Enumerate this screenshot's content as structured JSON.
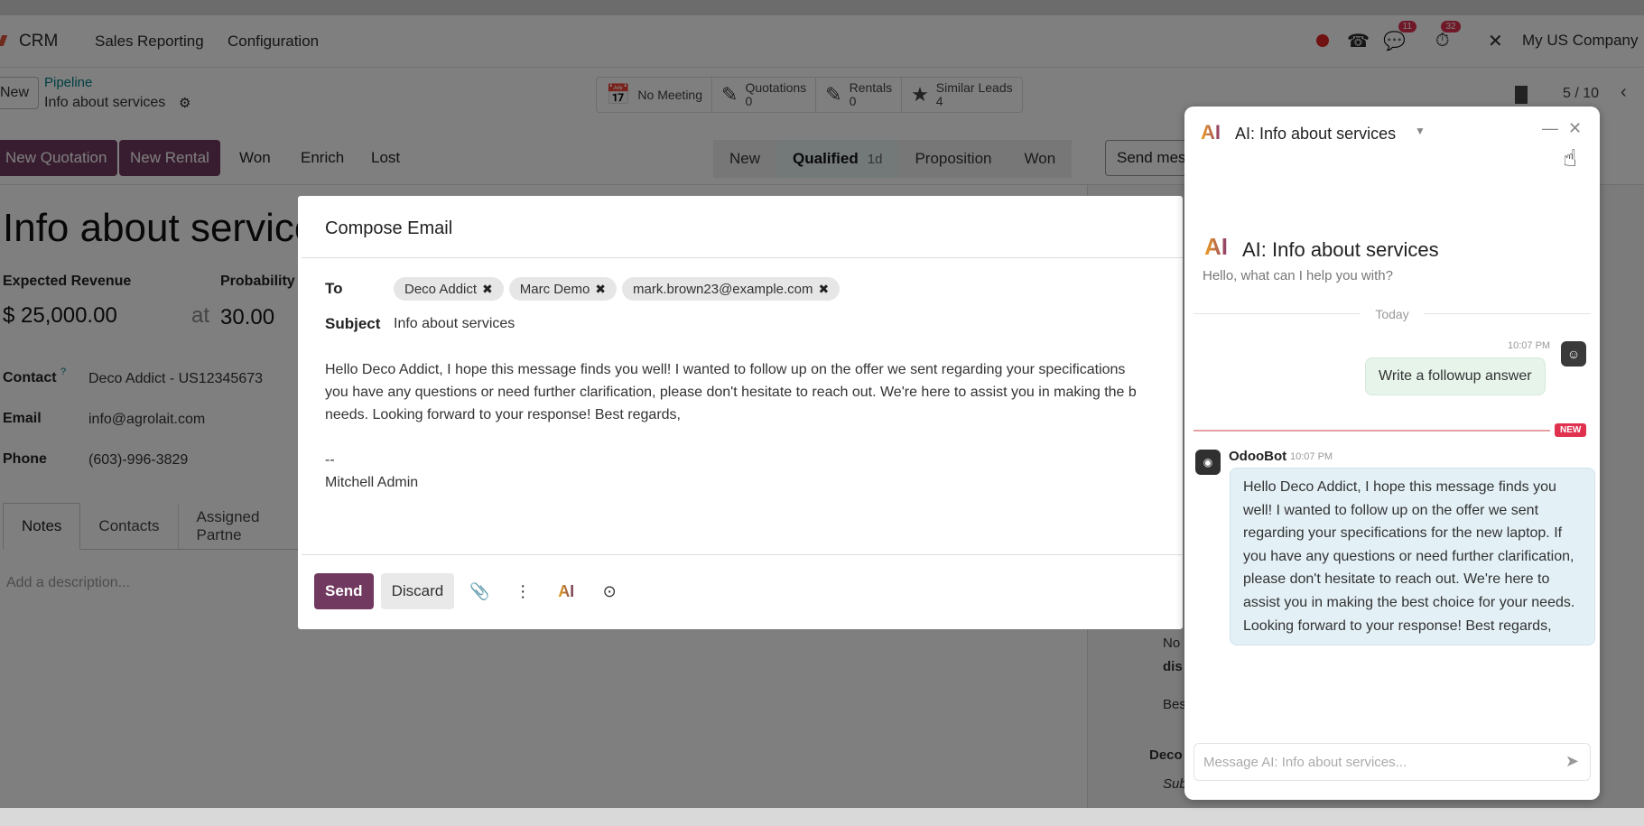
{
  "navbar": {
    "app": "CRM",
    "menu": [
      "Sales",
      "Reporting",
      "Configuration"
    ],
    "chat_badge": "11",
    "activity_badge": "32",
    "company": "My US Company"
  },
  "breadcrumb": {
    "new_label": "New",
    "parent": "Pipeline",
    "current": "Info about services"
  },
  "smart_buttons": [
    {
      "icon": "calendar-icon",
      "glyph": "📅",
      "label": "No Meeting",
      "count": ""
    },
    {
      "icon": "edit-icon",
      "glyph": "✎",
      "label": "Quotations",
      "count": "0"
    },
    {
      "icon": "edit-icon",
      "glyph": "✎",
      "label": "Rentals",
      "count": "0"
    },
    {
      "icon": "star-icon",
      "glyph": "★",
      "label": "Similar Leads",
      "count": "4"
    }
  ],
  "pager": "5 / 10",
  "statusbar": {
    "new_quotation": "New Quotation",
    "new_rental": "New Rental",
    "won": "Won",
    "enrich": "Enrich",
    "lost": "Lost",
    "stages": [
      "New",
      "Qualified",
      "Proposition",
      "Won"
    ],
    "active_stage_duration": "1d",
    "send_message": "Send mes"
  },
  "record": {
    "title": "Info about services",
    "expected_revenue_label": "Expected Revenue",
    "expected_revenue": "$ 25,000.00",
    "probability_label": "Probability",
    "at": "at",
    "probability": "30.00",
    "contact_label": "Contact",
    "contact_help": "?",
    "contact": "Deco Addict - US12345673",
    "email_label": "Email",
    "email": "info@agrolait.com",
    "phone_label": "Phone",
    "phone": "(603)-996-3829",
    "tabs": [
      "Notes",
      "Contacts",
      "Assigned Partne"
    ],
    "description_placeholder": "Add a description...",
    "chatter_snippets": [
      "No",
      "dis",
      "Bes",
      "Deco",
      "Sub"
    ]
  },
  "compose": {
    "title": "Compose Email",
    "to_label": "To",
    "recipients": [
      "Deco Addict",
      "Marc Demo",
      "mark.brown23@example.com"
    ],
    "subject_label": "Subject",
    "subject": "Info about services",
    "body": "Hello Deco Addict, I hope this message finds you well! I wanted to follow up on the offer we sent regarding your specifications\nyou have any questions or need further clarification, please don't hesitate to reach out. We're here to assist you in making the b\nneeds. Looking forward to your response! Best regards,\n\n--\nMitchell Admin",
    "send": "Send",
    "discard": "Discard"
  },
  "ai_chat": {
    "title": "AI: Info about services",
    "intro_title": "AI: Info about services",
    "intro_sub": "Hello, what can I help you with?",
    "day": "Today",
    "user_time": "10:07 PM",
    "user_message": "Write a followup answer",
    "new_badge": "NEW",
    "bot_name": "OdooBot",
    "bot_time": "10:07 PM",
    "bot_message": "Hello Deco Addict, I hope this message finds you well! I wanted to follow up on the offer we sent regarding your specifications for the new laptop. If you have any questions or need further clarification, please don't hesitate to reach out. We're here to assist you in making the best choice for your needs. Looking forward to your response! Best regards,",
    "composer_placeholder": "Message AI: Info about services..."
  },
  "colors": {
    "primary": "#71395f",
    "link": "#017e84",
    "badge": "#e0314f"
  }
}
